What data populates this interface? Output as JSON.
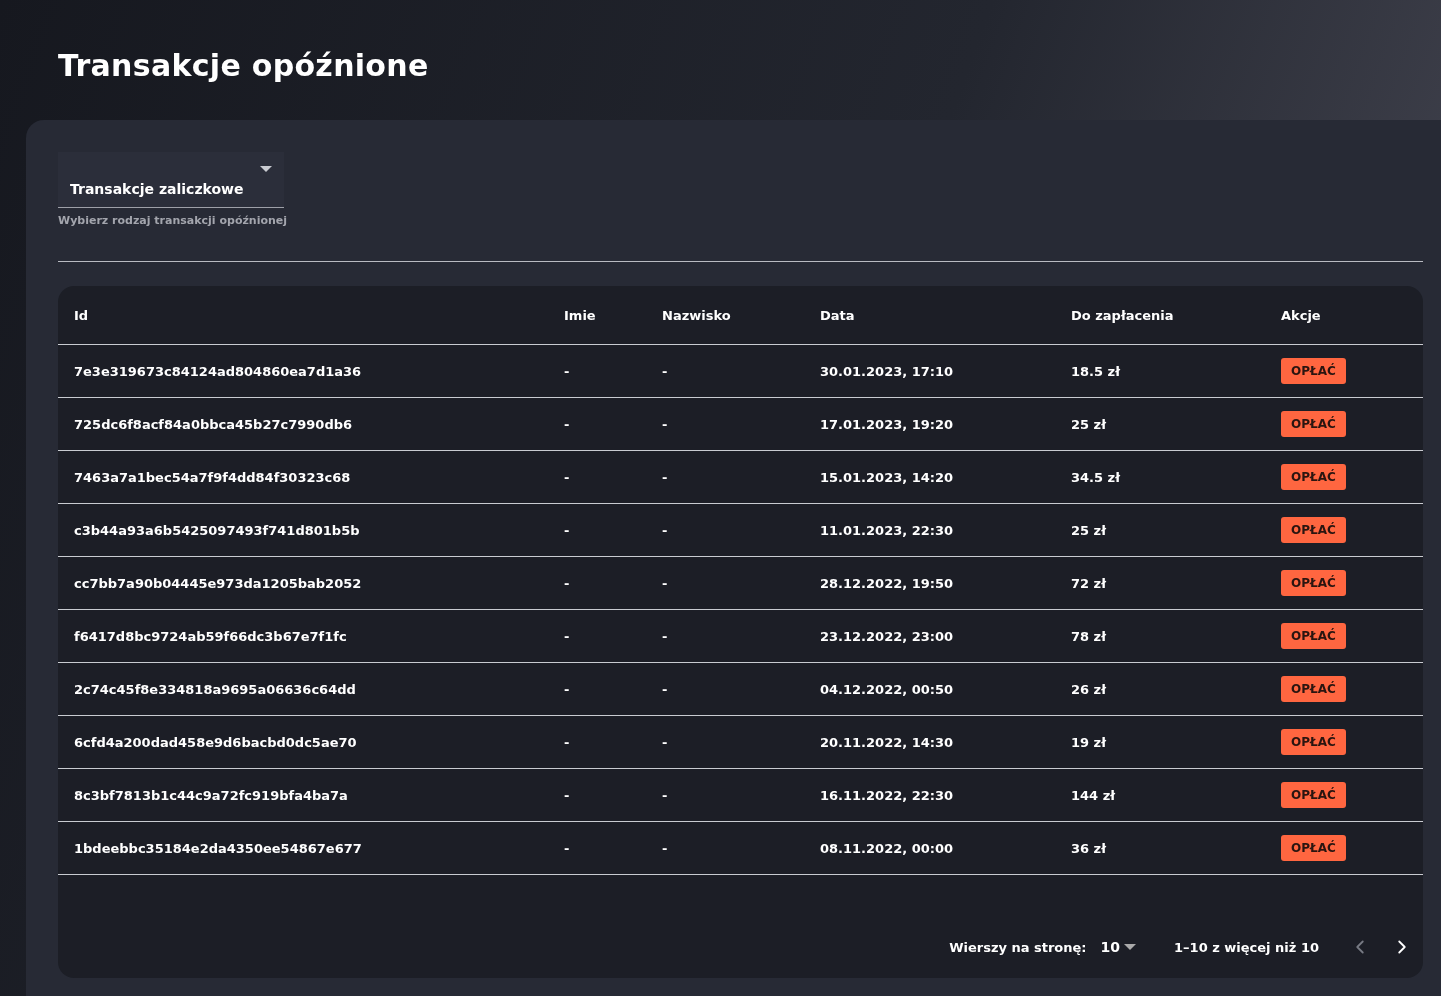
{
  "title": "Transakcje opóźnione",
  "filter": {
    "value": "Transakcje zaliczkowe",
    "helper": "Wybierz rodzaj transakcji opóźnionej"
  },
  "table": {
    "columns": [
      "Id",
      "Imie",
      "Nazwisko",
      "Data",
      "Do zapłacenia",
      "Akcje"
    ],
    "rows": [
      {
        "id": "7e3e319673c84124ad804860ea7d1a36",
        "first_name": "-",
        "last_name": "-",
        "date": "30.01.2023, 17:10",
        "amount": "18.5 zł",
        "action": "OPŁAĆ"
      },
      {
        "id": "725dc6f8acf84a0bbca45b27c7990db6",
        "first_name": "-",
        "last_name": "-",
        "date": "17.01.2023, 19:20",
        "amount": "25 zł",
        "action": "OPŁAĆ"
      },
      {
        "id": "7463a7a1bec54a7f9f4dd84f30323c68",
        "first_name": "-",
        "last_name": "-",
        "date": "15.01.2023, 14:20",
        "amount": "34.5 zł",
        "action": "OPŁAĆ"
      },
      {
        "id": "c3b44a93a6b5425097493f741d801b5b",
        "first_name": "-",
        "last_name": "-",
        "date": "11.01.2023, 22:30",
        "amount": "25 zł",
        "action": "OPŁAĆ"
      },
      {
        "id": "cc7bb7a90b04445e973da1205bab2052",
        "first_name": "-",
        "last_name": "-",
        "date": "28.12.2022, 19:50",
        "amount": "72 zł",
        "action": "OPŁAĆ"
      },
      {
        "id": "f6417d8bc9724ab59f66dc3b67e7f1fc",
        "first_name": "-",
        "last_name": "-",
        "date": "23.12.2022, 23:00",
        "amount": "78 zł",
        "action": "OPŁAĆ"
      },
      {
        "id": "2c74c45f8e334818a9695a06636c64dd",
        "first_name": "-",
        "last_name": "-",
        "date": "04.12.2022, 00:50",
        "amount": "26 zł",
        "action": "OPŁAĆ"
      },
      {
        "id": "6cfd4a200dad458e9d6bacbd0dc5ae70",
        "first_name": "-",
        "last_name": "-",
        "date": "20.11.2022, 14:30",
        "amount": "19 zł",
        "action": "OPŁAĆ"
      },
      {
        "id": "8c3bf7813b1c44c9a72fc919bfa4ba7a",
        "first_name": "-",
        "last_name": "-",
        "date": "16.11.2022, 22:30",
        "amount": "144 zł",
        "action": "OPŁAĆ"
      },
      {
        "id": "1bdeebbc35184e2da4350ee54867e677",
        "first_name": "-",
        "last_name": "-",
        "date": "08.11.2022, 00:00",
        "amount": "36 zł",
        "action": "OPŁAĆ"
      }
    ]
  },
  "pagination": {
    "rows_label": "Wierszy na stronę:",
    "rows_value": "10",
    "range": "1–10 z więcej niż 10",
    "prev": {
      "disabled": true
    },
    "next": {
      "disabled": false
    }
  }
}
